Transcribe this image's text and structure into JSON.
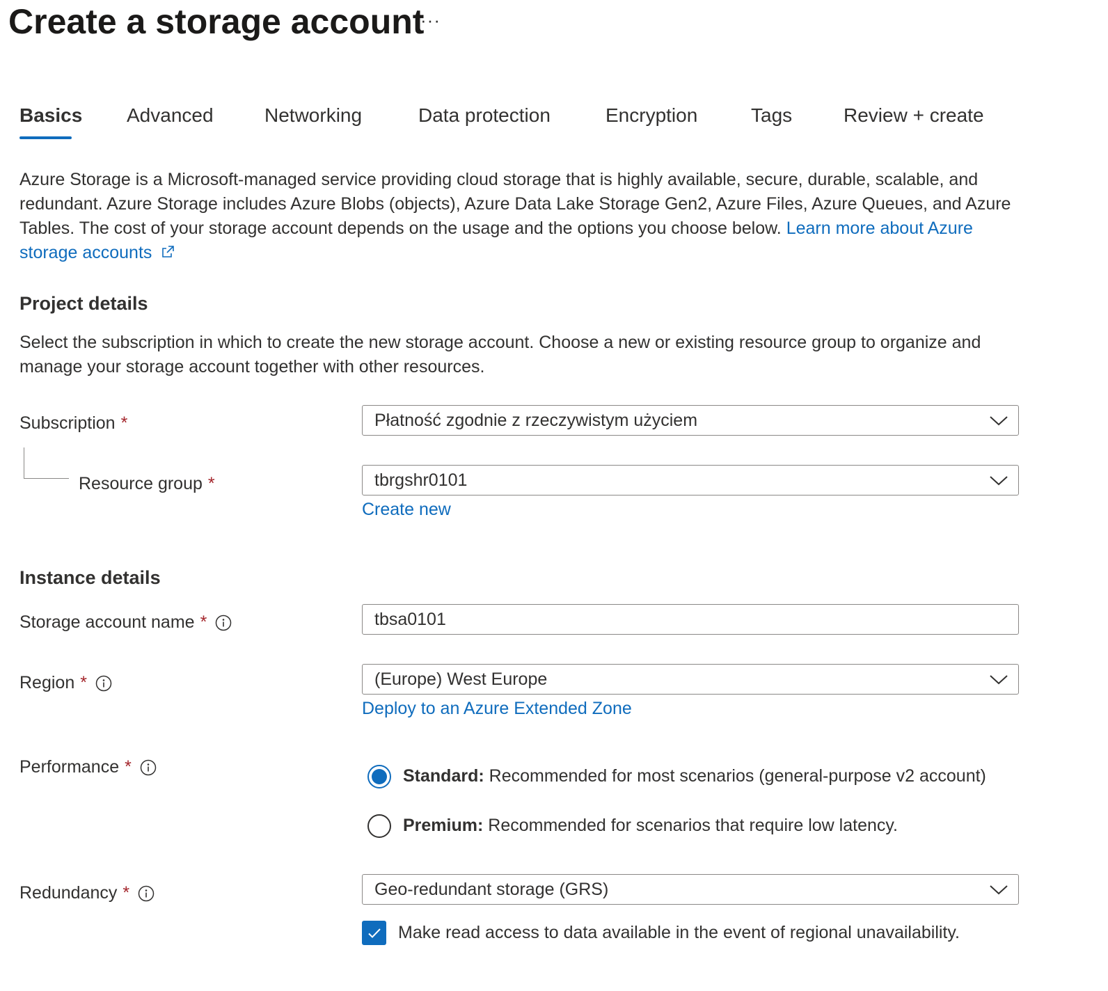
{
  "page": {
    "title": "Create a storage account",
    "more_label": "···"
  },
  "tabs": [
    {
      "label": "Basics",
      "active": true
    },
    {
      "label": "Advanced"
    },
    {
      "label": "Networking"
    },
    {
      "label": "Data protection"
    },
    {
      "label": "Encryption"
    },
    {
      "label": "Tags"
    },
    {
      "label": "Review + create"
    }
  ],
  "intro": {
    "text": "Azure Storage is a Microsoft-managed service providing cloud storage that is highly available, secure, durable, scalable, and redundant. Azure Storage includes Azure Blobs (objects), Azure Data Lake Storage Gen2, Azure Files, Azure Queues, and Azure Tables. The cost of your storage account depends on the usage and the options you choose below.",
    "link": "Learn more about Azure storage accounts"
  },
  "project": {
    "title": "Project details",
    "description": "Select the subscription in which to create the new storage account. Choose a new or existing resource group to organize and manage your storage account together with other resources.",
    "subscription_label": "Subscription",
    "subscription_value": "Płatność zgodnie z rzeczywistym użyciem",
    "resource_group_label": "Resource group",
    "resource_group_value": "tbrgshr0101",
    "create_new": "Create new"
  },
  "instance": {
    "title": "Instance details",
    "name_label": "Storage account name",
    "name_value": "tbsa0101",
    "region_label": "Region",
    "region_value": "(Europe) West Europe",
    "extended_zone_link": "Deploy to an Azure Extended Zone",
    "performance_label": "Performance",
    "performance_options": [
      {
        "title": "Standard:",
        "desc": "Recommended for most scenarios (general-purpose v2 account)",
        "selected": true
      },
      {
        "title": "Premium:",
        "desc": "Recommended for scenarios that require low latency.",
        "selected": false
      }
    ],
    "redundancy_label": "Redundancy",
    "redundancy_value": "Geo-redundant storage (GRS)",
    "read_access_label": "Make read access to data available in the event of regional unavailability.",
    "read_access_checked": true
  },
  "required_marker": "*",
  "colors": {
    "accent": "#0f6cbd",
    "required": "#a4262c",
    "text": "#323130"
  },
  "icons": [
    "more-icon",
    "external-link-icon",
    "chevron-down-icon",
    "info-icon",
    "checkmark-icon"
  ]
}
